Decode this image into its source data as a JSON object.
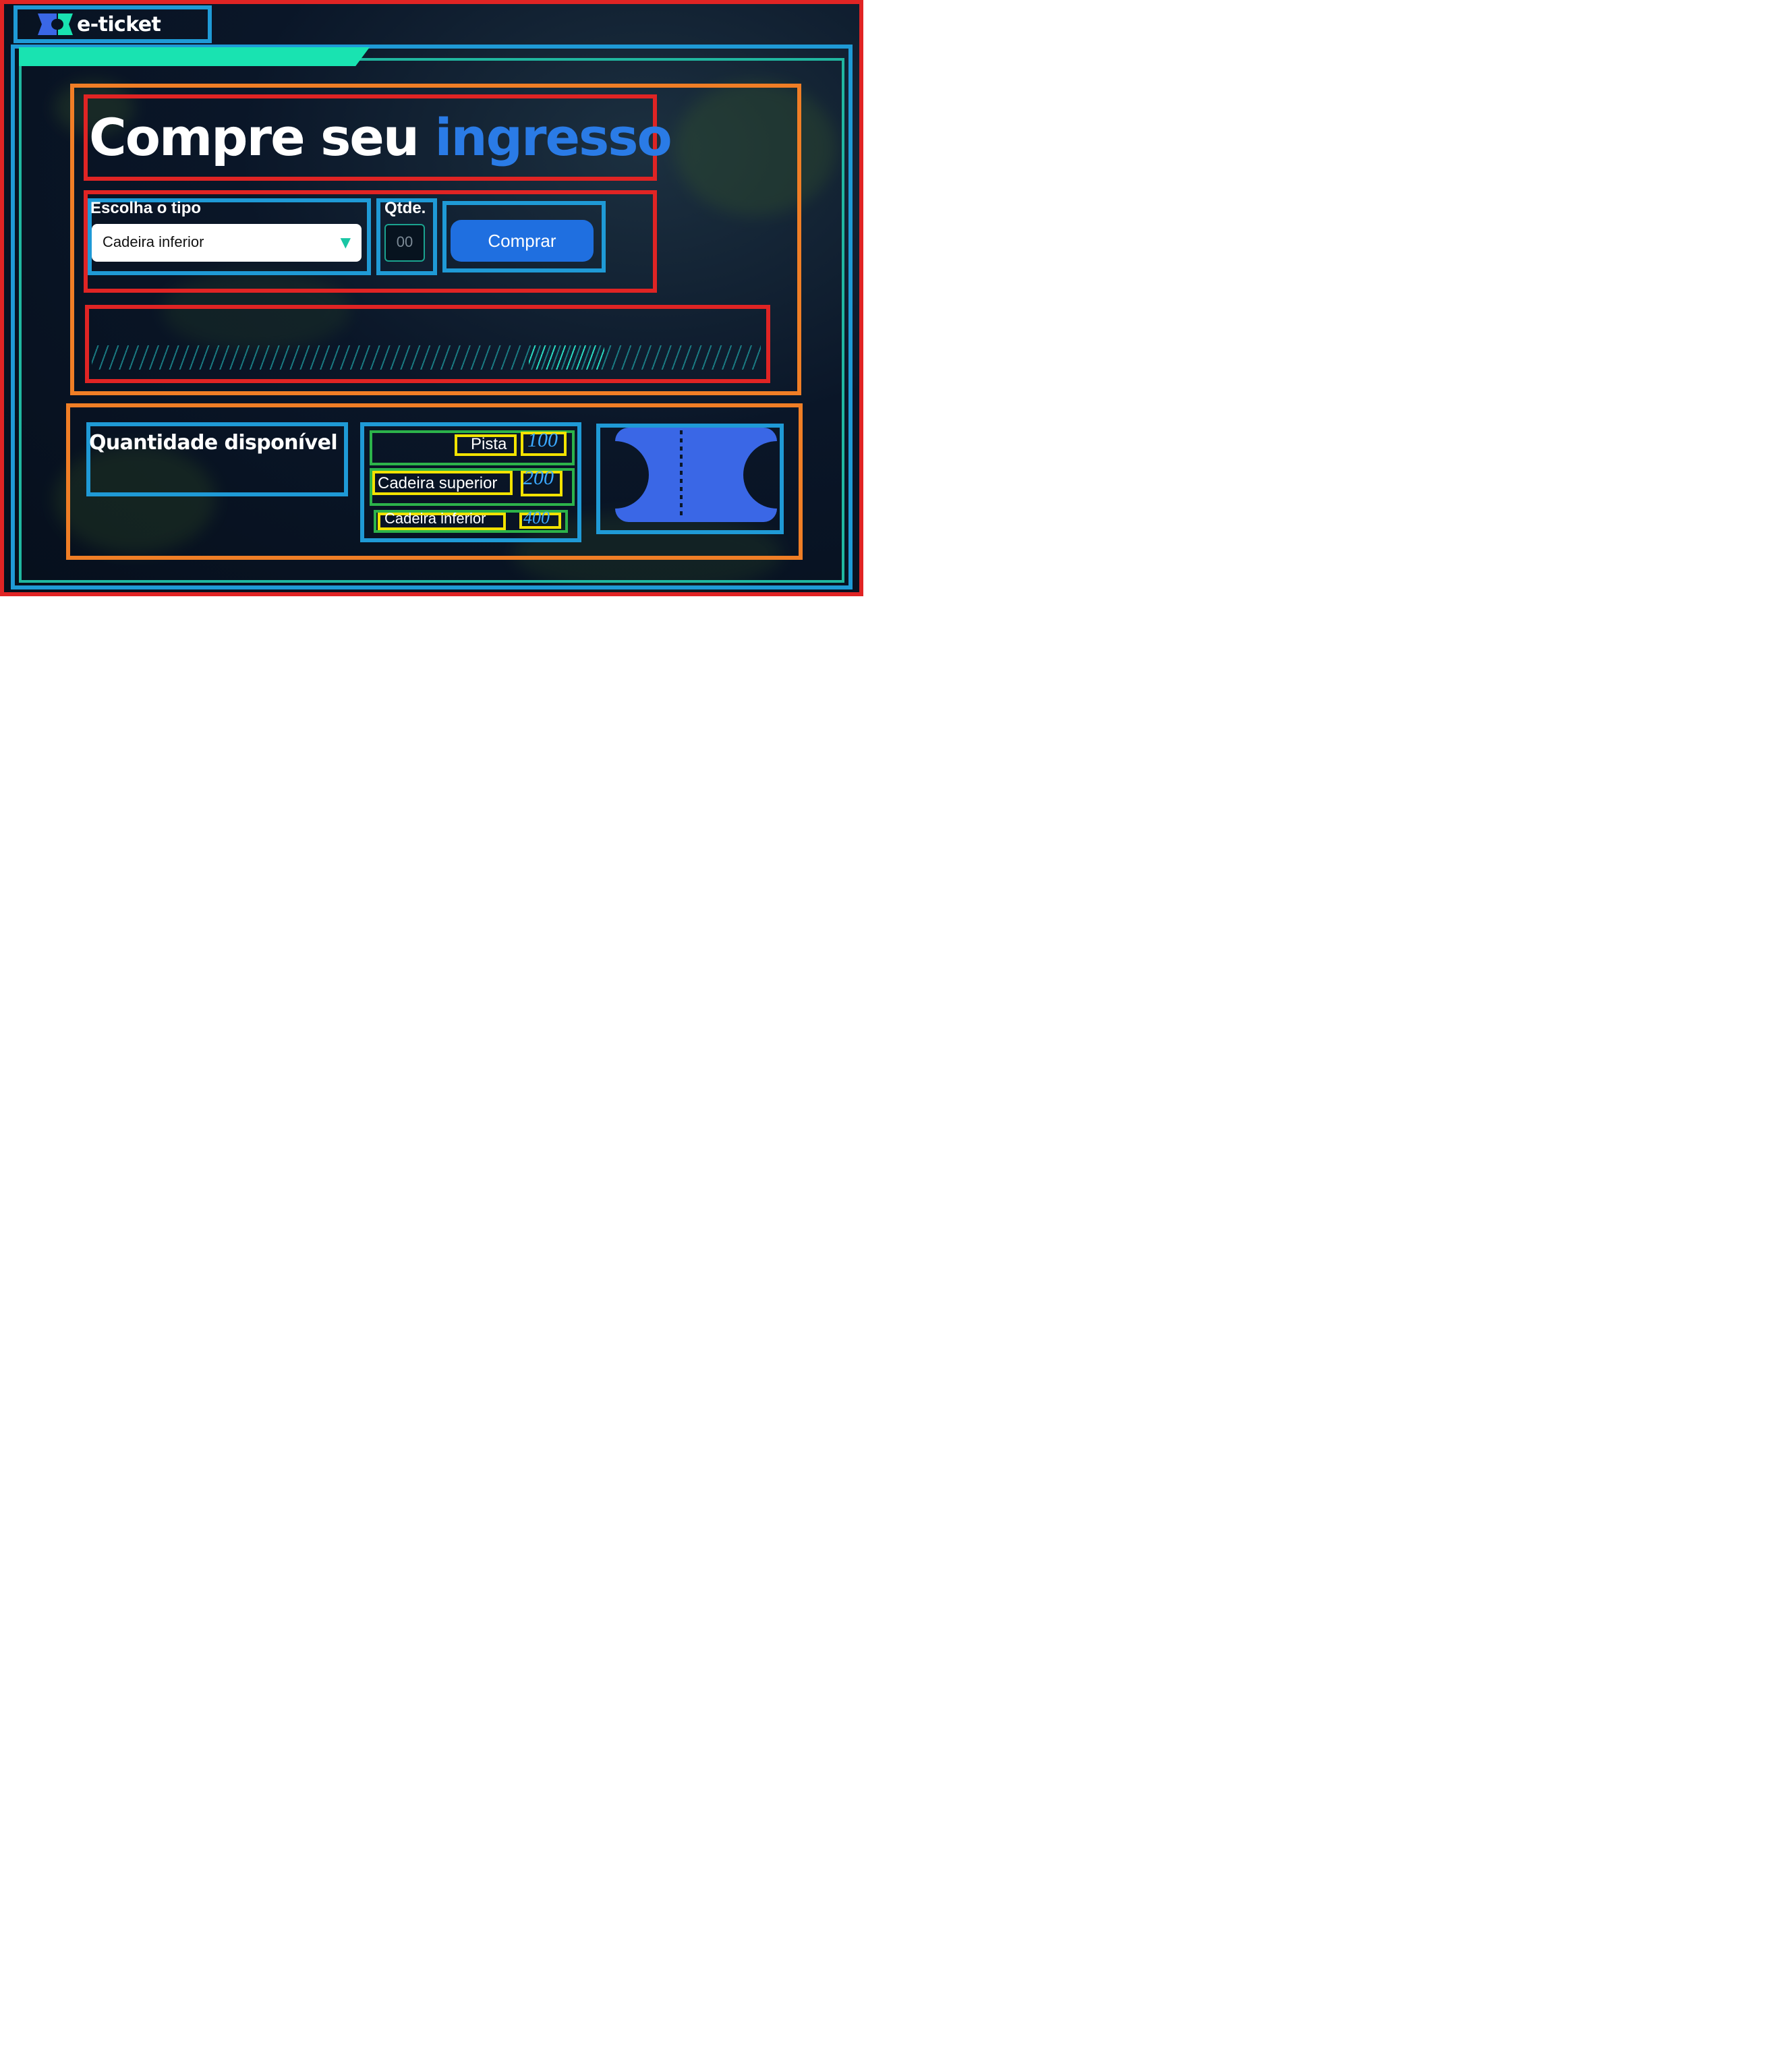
{
  "app": {
    "brand_name": "e-ticket",
    "logo_icon": "ticket-logo-icon"
  },
  "colors": {
    "background": "#0a1628",
    "accent_blue": "#2a7be6",
    "accent_teal": "#19e3b1",
    "button_blue": "#1f6fe0",
    "ticket_blue": "#3a67e6"
  },
  "hero": {
    "title_part1": "Compre seu",
    "title_part2": "ingresso"
  },
  "form": {
    "type_label": "Escolha o tipo",
    "type_selected": "Cadeira inferior",
    "qty_label": "Qtde.",
    "qty_placeholder": "00",
    "buy_button_label": "Comprar"
  },
  "availability": {
    "title": "Quantidade disponível",
    "items": [
      {
        "label": "Pista",
        "value": "100"
      },
      {
        "label": "Cadeira superior",
        "value": "200"
      },
      {
        "label": "Cadeira inferior",
        "value": "400"
      }
    ]
  }
}
